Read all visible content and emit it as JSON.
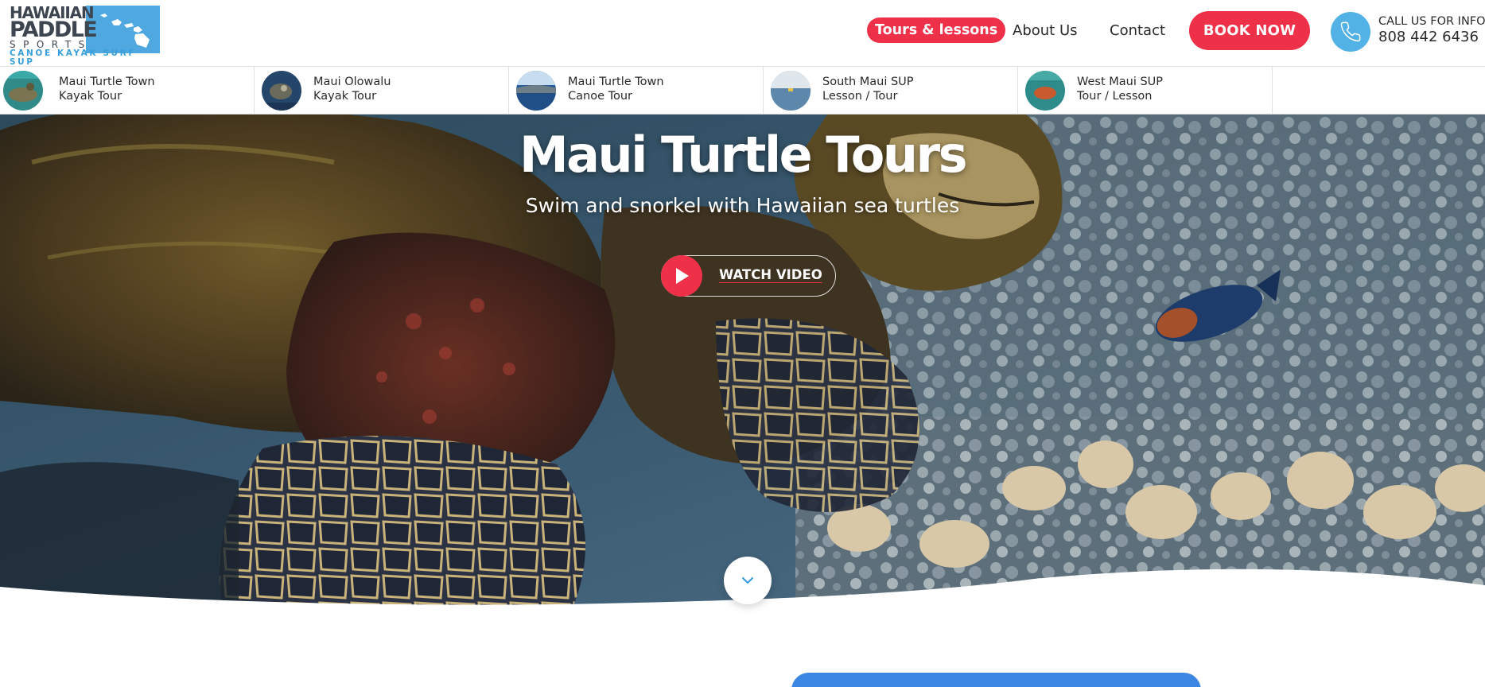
{
  "logo": {
    "line1": "HAWAIIAN",
    "line2": "PADDLE",
    "line3": "SPORTS",
    "line4": "CANOE KAYAK SURF SUP",
    "icon": "hawaiian-islands-icon"
  },
  "nav": {
    "tours": "Tours & lessons",
    "about": "About Us",
    "contact": "Contact",
    "book": "BOOK NOW"
  },
  "call": {
    "label": "CALL US FOR INFO",
    "number": "808 442 6436",
    "icon": "phone-icon"
  },
  "tours_strip": [
    {
      "line1": "Maui Turtle Town",
      "line2": "Kayak Tour"
    },
    {
      "line1": "Maui Olowalu",
      "line2": "Kayak Tour"
    },
    {
      "line1": "Maui Turtle Town",
      "line2": "Canoe Tour"
    },
    {
      "line1": "South Maui SUP",
      "line2": "Lesson / Tour"
    },
    {
      "line1": "West Maui SUP",
      "line2": "Tour / Lesson"
    }
  ],
  "hero": {
    "title": "Maui Turtle Tours",
    "subtitle": "Swim and snorkel with Hawaiian sea turtles",
    "watch_label": "WATCH VIDEO",
    "play_icon": "play-icon",
    "scroll_icon": "chevron-down-icon"
  },
  "colors": {
    "brand_red": "#ee3048",
    "brand_blue": "#52b2e6",
    "card_blue": "#3b86e0"
  }
}
